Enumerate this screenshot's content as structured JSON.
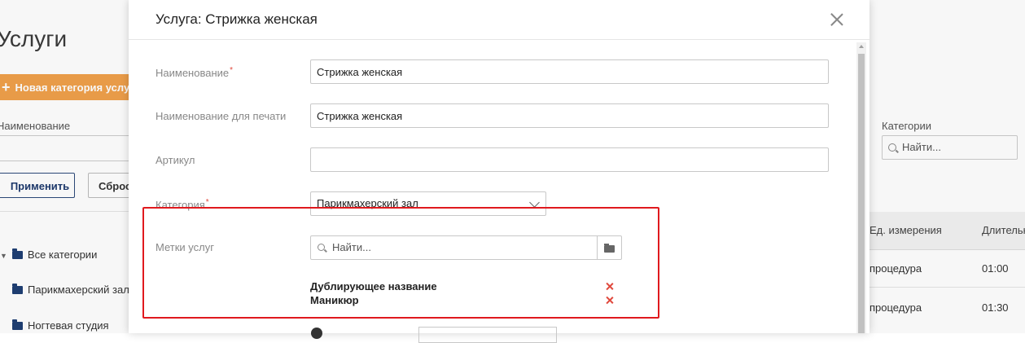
{
  "background": {
    "page_title": "Услуги",
    "new_category_button": "Новая категория услуг",
    "filter_name_label": "Наименование",
    "apply_button": "Применить",
    "reset_button": "Сброс",
    "category_filter_label": "Категории",
    "category_search_placeholder": "Найти...",
    "tree": [
      {
        "label": "Все категории"
      },
      {
        "label": "Парикмахерский зал"
      },
      {
        "label": "Ногтевая студия"
      }
    ],
    "table": {
      "headers": [
        "Ед. измерения",
        "Длительн"
      ],
      "rows": [
        [
          "процедура",
          "01:00"
        ],
        [
          "процедура",
          "01:30"
        ]
      ]
    }
  },
  "modal": {
    "title": "Услуга: Стрижка женская",
    "fields": {
      "name": {
        "label": "Наименование",
        "required": "*",
        "value": "Стрижка женская"
      },
      "print_name": {
        "label": "Наименование для печати",
        "value": "Стрижка женская"
      },
      "article": {
        "label": "Артикул",
        "value": ""
      },
      "category": {
        "label": "Категория",
        "required": "*",
        "value": "Парикмахерский зал"
      },
      "tags": {
        "label": "Метки услуг",
        "search_placeholder": "Найти...",
        "items": [
          {
            "label": "Дублирующее название"
          },
          {
            "label": "Маникюр"
          }
        ]
      }
    }
  }
}
